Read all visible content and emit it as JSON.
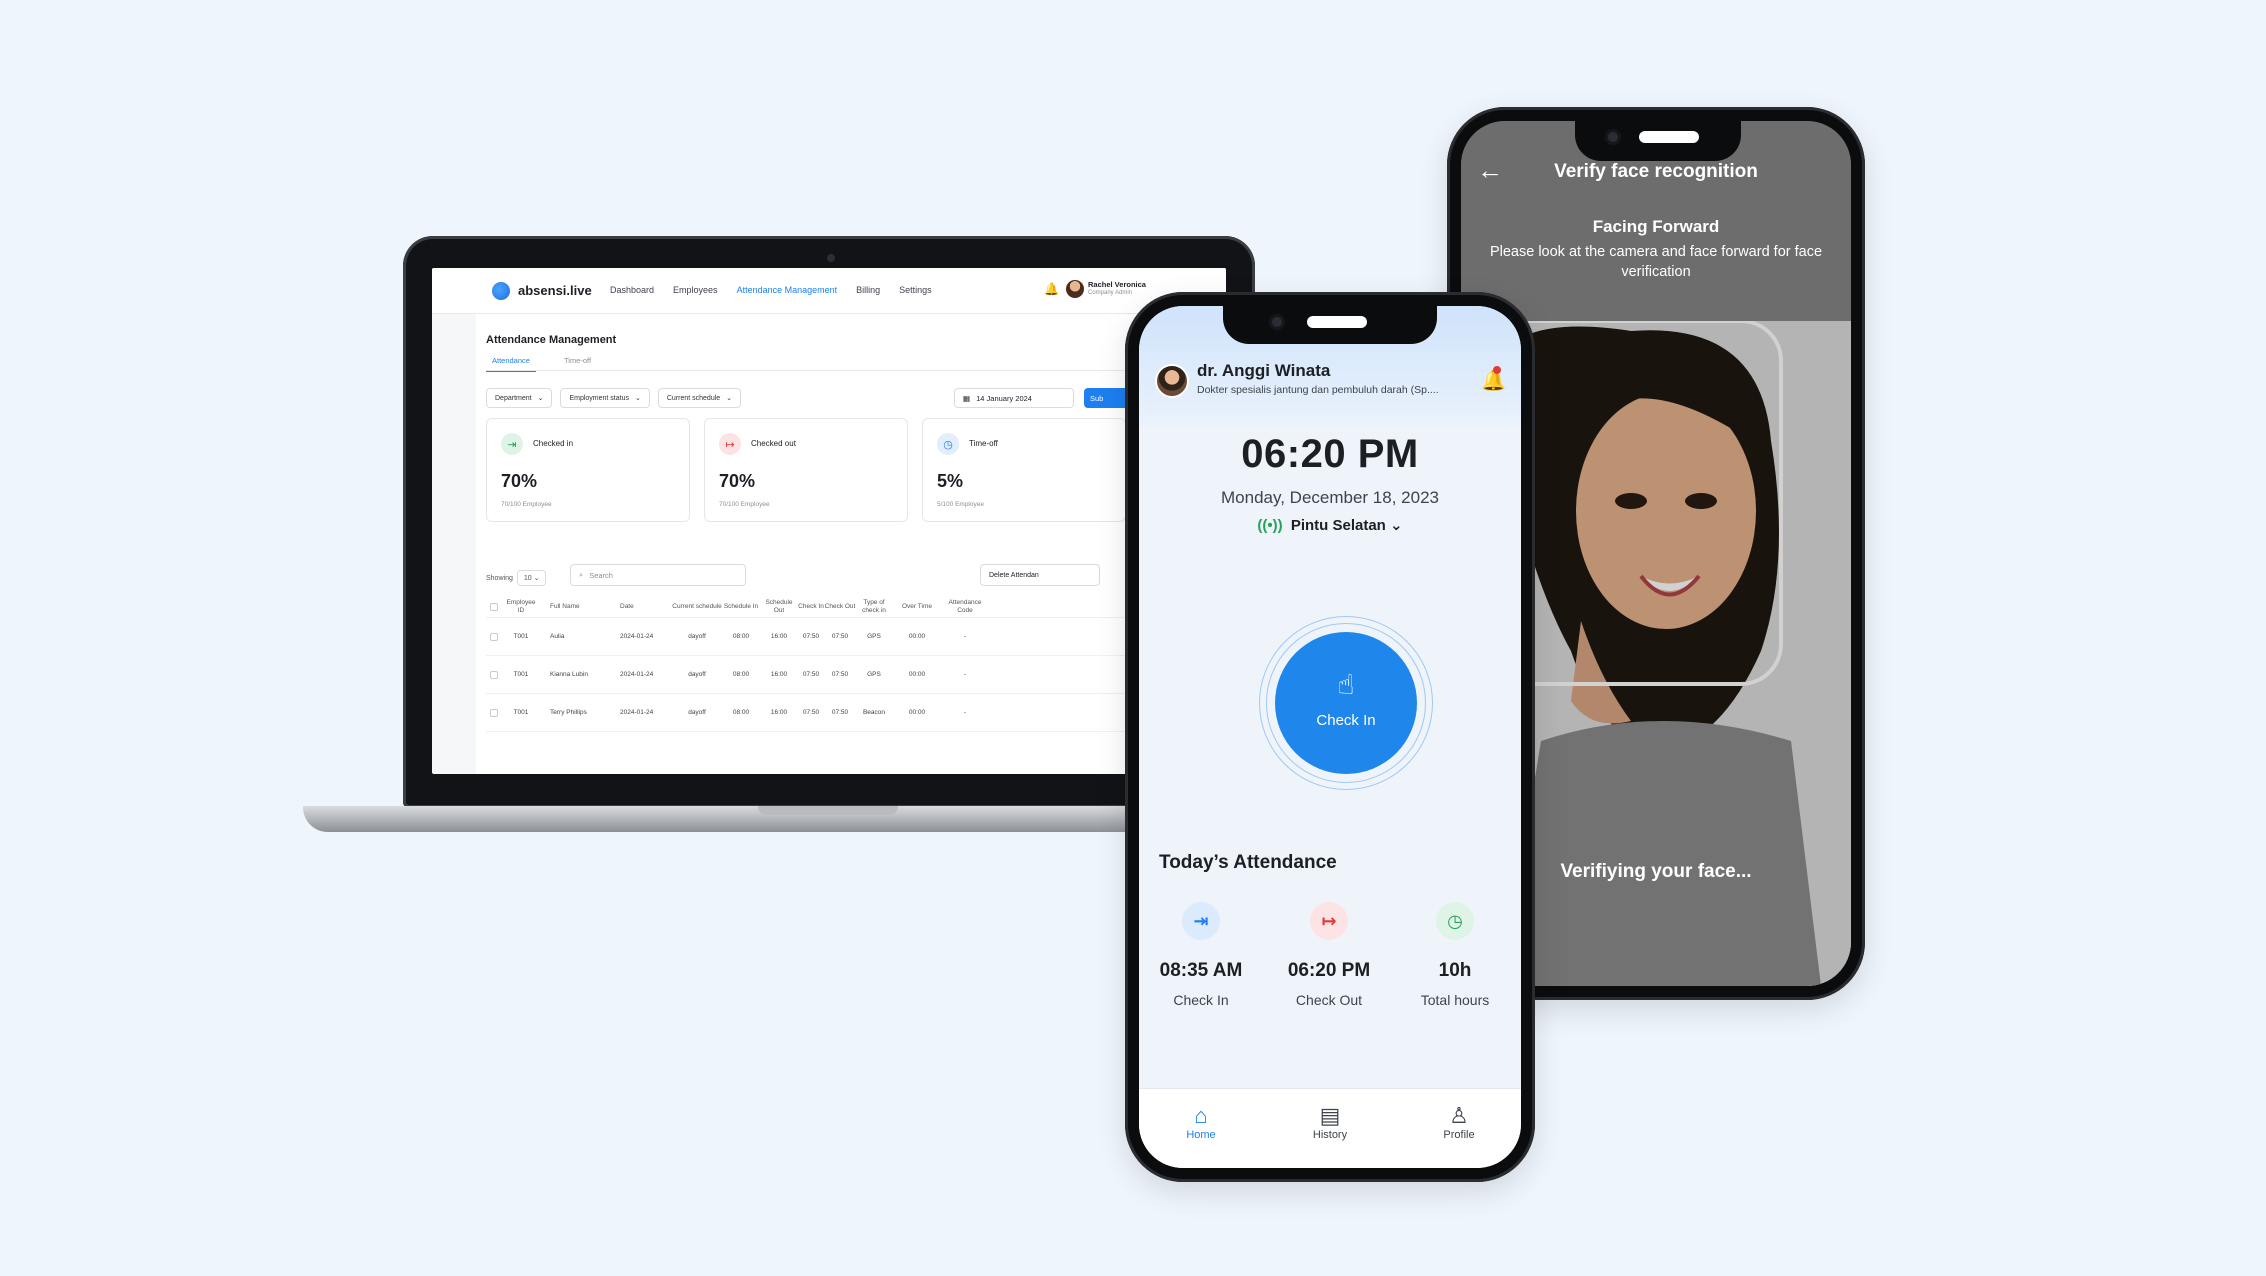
{
  "web": {
    "brand": "absensi.live",
    "nav": [
      "Dashboard",
      "Employees",
      "Attendance Management",
      "Billing",
      "Settings"
    ],
    "user": {
      "name": "Rachel Veronica",
      "role": "Company Admin"
    },
    "page_title": "Attendance Management",
    "tabs": [
      "Attendance",
      "Time-off"
    ],
    "filters": [
      "Department",
      "Employment status",
      "Current schedule"
    ],
    "date": "14 January 2024",
    "submit_label": "Sub",
    "stats": [
      {
        "label": "Checked in",
        "value": "70%",
        "sub": "70/100 Employee",
        "color": "#22a35a"
      },
      {
        "label": "Checked out",
        "value": "70%",
        "sub": "70/100 Employee",
        "color": "#e53935"
      },
      {
        "label": "Time-off",
        "value": "5%",
        "sub": "5/100 Employee",
        "color": "#1d7ff0"
      }
    ],
    "showing_label": "Showing",
    "showing_value": "10",
    "search_placeholder": "Search",
    "delete_label": "Delete Attendan",
    "columns": [
      "Employee ID",
      "Full Name",
      "Date",
      "Current schedule",
      "Schedule In",
      "Schedule Out",
      "Check In",
      "Check Out",
      "Type of check in",
      "Over Time",
      "Attendance Code"
    ],
    "rows": [
      [
        "T001",
        "Aulia",
        "2024-01-24",
        "dayoff",
        "08:00",
        "16:00",
        "07:50",
        "07:50",
        "GPS",
        "00:00",
        "-"
      ],
      [
        "T001",
        "Kianna Lubin",
        "2024-01-24",
        "dayoff",
        "08:00",
        "16:00",
        "07:50",
        "07:50",
        "GPS",
        "00:00",
        "-"
      ],
      [
        "T001",
        "Terry Phillips",
        "2024-01-24",
        "dayoff",
        "08:00",
        "16:00",
        "07:50",
        "07:50",
        "Beacon",
        "00:00",
        "-"
      ]
    ]
  },
  "face": {
    "title": "Verify face recognition",
    "facing_title": "Facing Forward",
    "facing_sub": "Please look at the camera and face forward for face verification",
    "status": "Verifiying your face..."
  },
  "app": {
    "doctor_name": "dr. Anggi Winata",
    "doctor_spec": "Dokter spesialis jantung dan pembuluh darah (Sp....",
    "time": "06:20 PM",
    "date": "Monday, December 18, 2023",
    "location": "Pintu Selatan",
    "check_in_label": "Check In",
    "today_title": "Today’s Attendance",
    "attendance": [
      {
        "value": "08:35 AM",
        "label": "Check In",
        "icon": "login-icon",
        "color": "#1d7ff0",
        "bg": "#dbeafc"
      },
      {
        "value": "06:20 PM",
        "label": "Check Out",
        "icon": "logout-icon",
        "color": "#e53935",
        "bg": "#fde3e3"
      },
      {
        "value": "10h",
        "label": "Total hours",
        "icon": "clock-icon",
        "color": "#22a35a",
        "bg": "#dff3e7"
      }
    ],
    "tabbar": [
      "Home",
      "History",
      "Profile"
    ]
  }
}
